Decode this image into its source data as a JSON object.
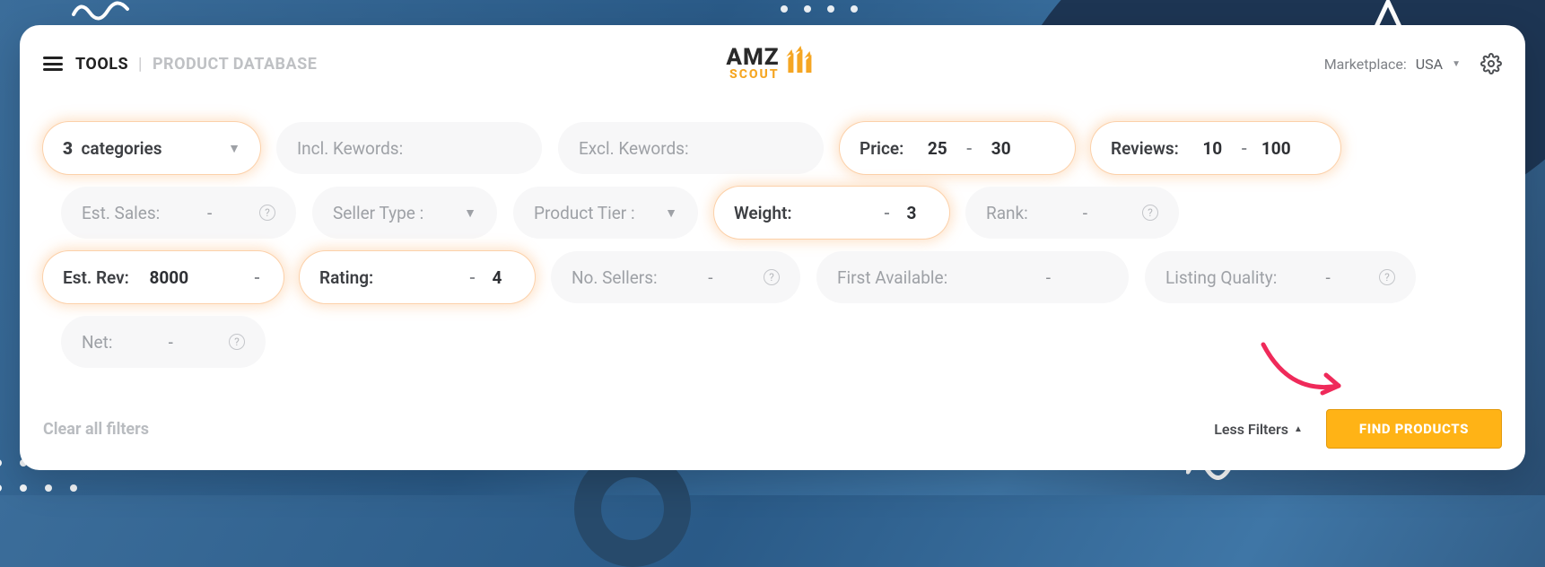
{
  "breadcrumb": {
    "tools": "TOOLS",
    "page": "PRODUCT DATABASE"
  },
  "logo": {
    "brand": "AMZ",
    "sub": "SCOUT"
  },
  "marketplace": {
    "label": "Marketplace:",
    "value": "USA"
  },
  "filters": {
    "categories": {
      "count": "3",
      "label": "categories"
    },
    "incl_keywords": {
      "label": "Incl. Kewords:",
      "value": ""
    },
    "excl_keywords": {
      "label": "Excl. Kewords:",
      "value": ""
    },
    "price": {
      "label": "Price:",
      "min": "25",
      "max": "30"
    },
    "reviews": {
      "label": "Reviews:",
      "min": "10",
      "max": "100"
    },
    "est_sales": {
      "label": "Est. Sales:",
      "min": "",
      "max": ""
    },
    "seller_type": {
      "label": "Seller Type :"
    },
    "product_tier": {
      "label": "Product Tier :"
    },
    "weight": {
      "label": "Weight:",
      "min": "",
      "max": "3"
    },
    "rank": {
      "label": "Rank:",
      "min": "",
      "max": ""
    },
    "est_rev": {
      "label": "Est. Rev:",
      "min": "8000",
      "max": ""
    },
    "rating": {
      "label": "Rating:",
      "min": "",
      "max": "4"
    },
    "no_sellers": {
      "label": "No. Sellers:",
      "min": "",
      "max": ""
    },
    "first_available": {
      "label": "First Available:",
      "min": "",
      "max": ""
    },
    "listing_quality": {
      "label": "Listing Quality:",
      "min": "",
      "max": ""
    },
    "net": {
      "label": "Net:",
      "min": "",
      "max": ""
    }
  },
  "actions": {
    "clear": "Clear all filters",
    "less": "Less Filters",
    "find": "FIND PRODUCTS"
  }
}
